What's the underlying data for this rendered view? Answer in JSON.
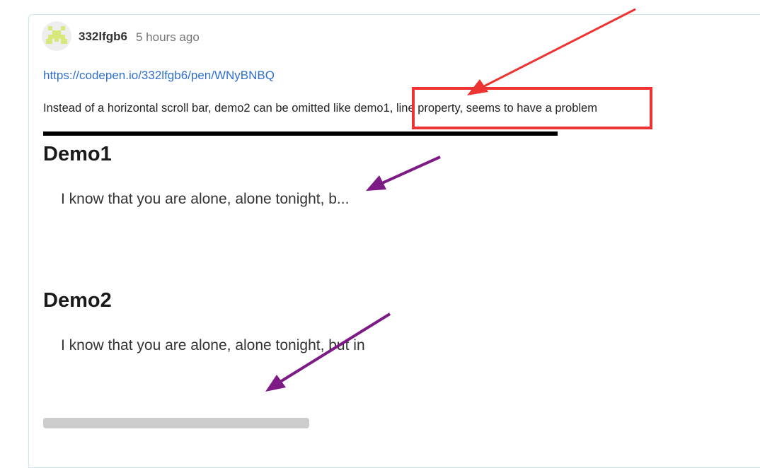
{
  "comment": {
    "username": "332lfgb6",
    "timestamp": "5 hours ago",
    "link": "https://codepen.io/332lfgb6/pen/WNyBNBQ",
    "message": "Instead of a horizontal scroll bar, demo2 can be omitted like demo1, line property, seems to have a problem"
  },
  "demo1": {
    "title": "Demo1",
    "text": "I know that you are alone, alone tonight, b..."
  },
  "demo2": {
    "title": "Demo2",
    "text": "I know that you are alone, alone tonight, but in"
  },
  "colors": {
    "link": "#2f6fd0",
    "highlight_box": "#ee3333",
    "red_arrow": "#ee3333",
    "purple_arrow": "#7d1a86",
    "avatar": "#d8e87a"
  },
  "icons": {
    "avatar": "identicon-avatar"
  }
}
